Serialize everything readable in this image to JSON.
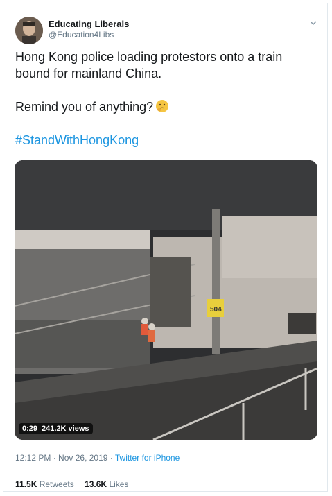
{
  "tweet": {
    "author_name": "Educating Liberals",
    "author_handle": "@Education4Libs",
    "line1": "Hong Kong police loading protestors onto a train bound for mainland China.",
    "line2": "Remind you of anything?",
    "emoji": "thinking-face",
    "hashtag": "#StandWithHongKong"
  },
  "video": {
    "duration": "0:29",
    "views": "241.2K views",
    "sign_text": "504"
  },
  "meta": {
    "time": "12:12 PM",
    "sep1": " · ",
    "date": "Nov 26, 2019",
    "sep2": " · ",
    "source": "Twitter for iPhone"
  },
  "stats": {
    "retweets_count": "11.5K",
    "retweets_label": "Retweets",
    "likes_count": "13.6K",
    "likes_label": "Likes"
  },
  "colors": {
    "link": "#1b95e0",
    "secondary_text": "#657786",
    "primary_text": "#14171a"
  }
}
